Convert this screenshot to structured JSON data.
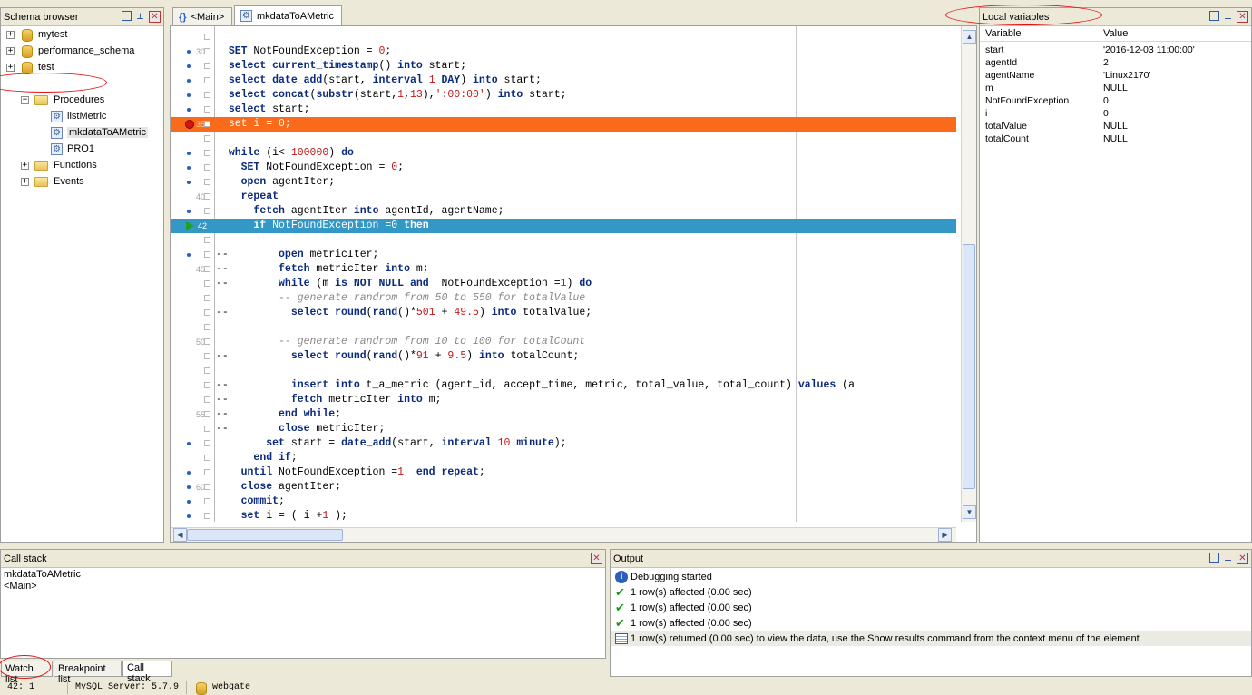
{
  "schema_browser": {
    "title": "Schema browser",
    "databases": [
      "mytest",
      "performance_schema",
      "test"
    ],
    "folders": [
      "Procedures",
      "Functions",
      "Events"
    ],
    "procedures": [
      "listMetric",
      "mkdataToAMetric",
      "PRO1"
    ]
  },
  "editor": {
    "tabs": [
      "<Main>",
      "mkdataToAMetric"
    ]
  },
  "local_variables": {
    "title": "Local variables",
    "col_variable": "Variable",
    "col_value": "Value",
    "rows": [
      {
        "name": "start",
        "value": "'2016-12-03 11:00:00'"
      },
      {
        "name": "agentId",
        "value": "2"
      },
      {
        "name": "agentName",
        "value": "'Linux2170'"
      },
      {
        "name": "m",
        "value": "NULL"
      },
      {
        "name": "NotFoundException",
        "value": "0"
      },
      {
        "name": "i",
        "value": "0"
      },
      {
        "name": "totalValue",
        "value": "NULL"
      },
      {
        "name": "totalCount",
        "value": "NULL"
      }
    ]
  },
  "call_stack": {
    "title": "Call stack",
    "items": [
      "mkdataToAMetric",
      "<Main>"
    ],
    "tabs": [
      "Watch list",
      "Breakpoint list",
      "Call stack"
    ]
  },
  "output": {
    "title": "Output",
    "rows": [
      {
        "icon": "info-icon",
        "text": "Debugging started"
      },
      {
        "icon": "check-icon",
        "text": "1 row(s) affected (0.00 sec)"
      },
      {
        "icon": "check-icon",
        "text": "1 row(s) affected (0.00 sec)"
      },
      {
        "icon": "check-icon",
        "text": "1 row(s) affected (0.00 sec)"
      },
      {
        "icon": "grid-icon",
        "text": "1 row(s) returned (0.00 sec) to view the data, use the Show results command from the context menu of the element"
      }
    ]
  },
  "status_bar": {
    "position": "42:   1",
    "server": "MySQL Server: 5.7.9",
    "database": "webgate"
  },
  "code": {
    "line_numbers": [
      "30",
      "35",
      "40",
      "42",
      "45",
      "50",
      "55",
      "60"
    ]
  }
}
